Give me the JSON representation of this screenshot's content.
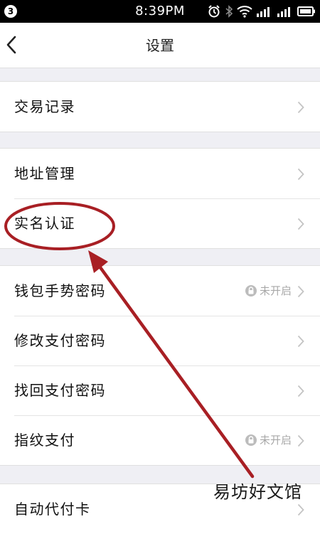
{
  "status_bar": {
    "badge": "3",
    "time": "8:39PM",
    "icons": [
      "alarm-icon",
      "bluetooth-icon",
      "wifi-icon",
      "signal-icon",
      "signal-icon",
      "battery-icon"
    ]
  },
  "header": {
    "title": "设置",
    "back_icon": "chevron-left-icon"
  },
  "groups": [
    {
      "items": [
        {
          "label": "交易记录"
        }
      ]
    },
    {
      "items": [
        {
          "label": "地址管理"
        },
        {
          "label": "实名认证"
        }
      ]
    },
    {
      "items": [
        {
          "label": "钱包手势密码",
          "status": "未开启"
        },
        {
          "label": "修改支付密码"
        },
        {
          "label": "找回支付密码"
        },
        {
          "label": "指纹支付",
          "status": "未开启"
        }
      ]
    },
    {
      "items": [
        {
          "label": "自动代付卡"
        }
      ]
    }
  ],
  "annotation": {
    "color": "#a81f24"
  },
  "watermark": "易坊好文馆"
}
